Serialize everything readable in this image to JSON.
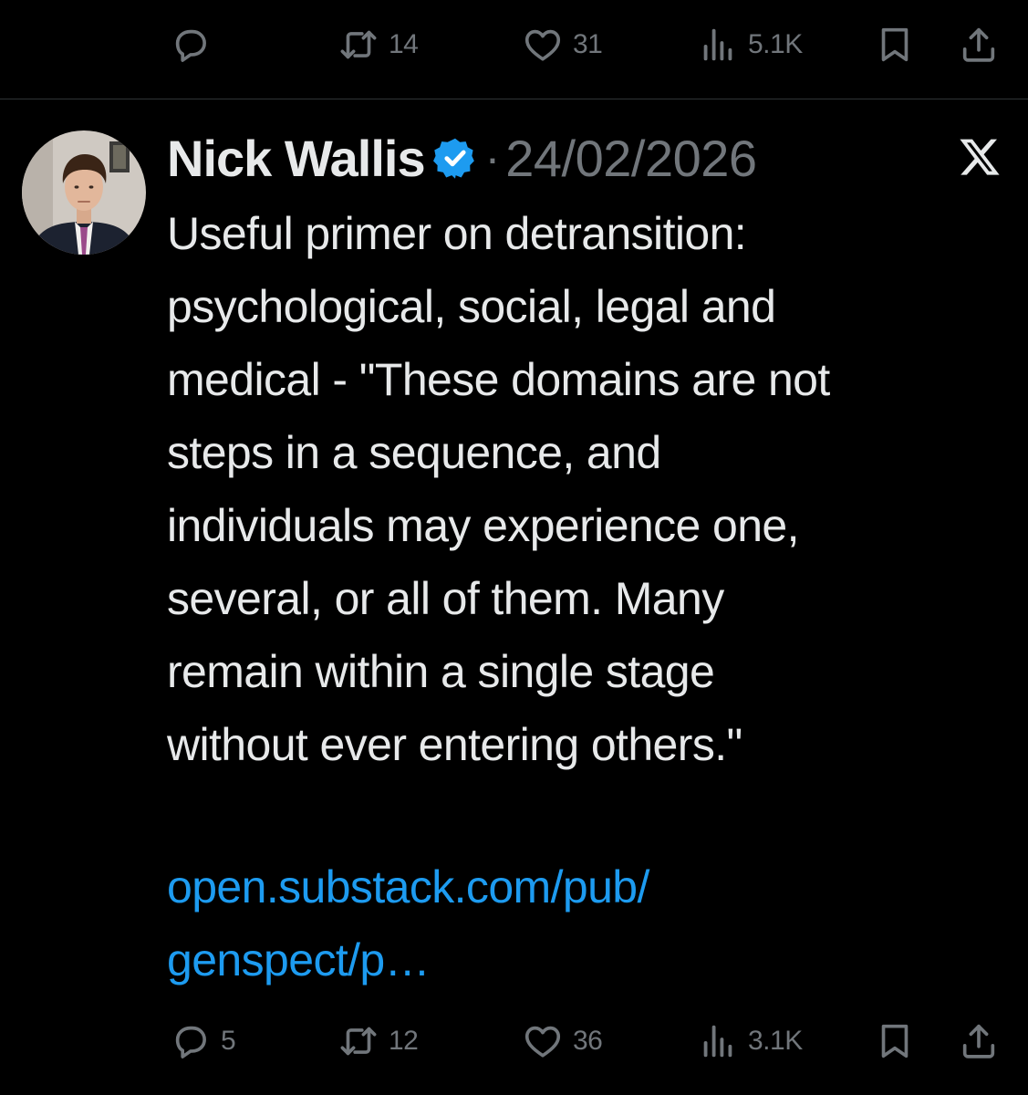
{
  "top_actions": {
    "replies": "",
    "reposts": "14",
    "likes": "31",
    "views": "5.1K"
  },
  "post": {
    "author_name": "Nick Wallis",
    "separator": "·",
    "date": "24/02/2026",
    "body": "Useful primer on detransition:\npsychological, social, legal and\nmedical - \"These domains are not\nsteps in a sequence, and\nindividuals may experience one,\nseveral, or all of them. Many\nremain within a single stage\nwithout ever entering others.\"",
    "link_text": "open.substack.com/pub/\ngenspect/p…"
  },
  "bottom_actions": {
    "replies": "5",
    "reposts": "12",
    "likes": "36",
    "views": "3.1K"
  },
  "icons": {
    "reply": "reply-icon",
    "repost": "repost-icon",
    "like": "heart-icon",
    "views": "views-icon",
    "bookmark": "bookmark-icon",
    "share": "share-icon",
    "verified": "verified-badge-icon",
    "platform": "x-logo-icon"
  },
  "colors": {
    "background": "#000000",
    "text": "#e7e9ea",
    "muted": "#71767b",
    "link": "#1d9bf0",
    "verified": "#1d9bf0",
    "divider": "#2f3336"
  }
}
